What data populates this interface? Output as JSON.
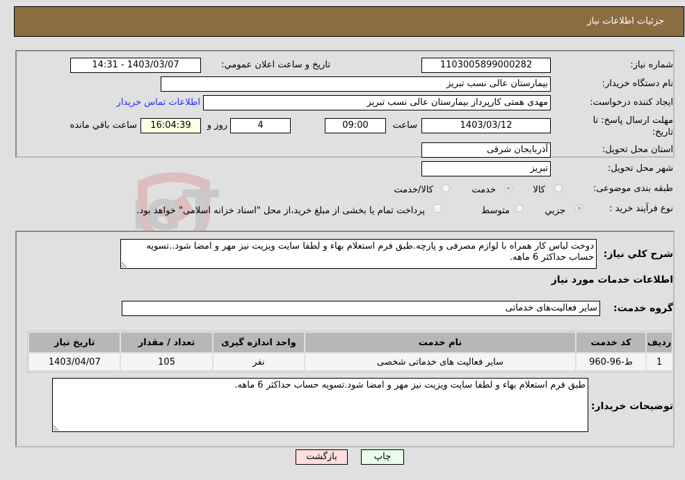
{
  "header": {
    "title": "جزئیات اطلاعات نیاز"
  },
  "form": {
    "need_number": {
      "label": "شماره نیاز:",
      "value": "1103005899000282"
    },
    "announce_datetime": {
      "label": "تاریخ و ساعت اعلان عمومي:",
      "value": "1403/03/07 - 14:31"
    },
    "buyer_org": {
      "label": "نام دستگاه خریدار:",
      "value": "بیمارستان عالی نسب تبریز"
    },
    "requester": {
      "label": "ایجاد کننده درخواست:",
      "value": "مهدی همتی کارپرداز بیمارستان عالی نسب تبریز",
      "contact_link": "اطلاعات تماس خریدار"
    },
    "deadline": {
      "label": "مهلت ارسال پاسخ: تا تاریخ:",
      "date": "1403/03/12",
      "time_label": "ساعت",
      "time": "09:00",
      "days": "4",
      "days_label": "روز و",
      "remaining": "16:04:39",
      "remaining_label": "ساعت باقي مانده"
    },
    "province": {
      "label": "استان محل تحویل:",
      "value": "آذربایجان شرقی"
    },
    "city": {
      "label": "شهر محل تحویل:",
      "value": "تبریز"
    },
    "category": {
      "label": "طبقه بندی موضوعی:",
      "options": [
        {
          "label": "کالا",
          "checked": false
        },
        {
          "label": "خدمت",
          "checked": true
        },
        {
          "label": "کالا/خدمت",
          "checked": false
        }
      ]
    },
    "purchase_type": {
      "label": "نوع فرآیند خرید :",
      "options": [
        {
          "label": "جزيي",
          "checked": true
        },
        {
          "label": "متوسط",
          "checked": false
        }
      ],
      "treasury_note": "پرداخت تمام یا بخشی از مبلغ خرید،از محل \"اسناد خزانه اسلامی\" خواهد بود."
    }
  },
  "description": {
    "label": "شرح کلي نیاز:",
    "value": "دوخت لباس کار همراه با لوازم مصرفی و پارچه.طبق فرم استعلام بهاء و لطفا سایت ویزیت نیز مهر و امضا شود..تسویه حساب حداکثر 6 ماهه."
  },
  "services": {
    "section_title": "اطلاعات خدمات مورد نیاز",
    "group_label": "گروه خدمت:",
    "group_value": "سایر فعالیت‌های خدماتی",
    "table": {
      "headers": [
        "ردیف",
        "کد خدمت",
        "نام خدمت",
        "واحد اندازه گیری",
        "تعداد / مقدار",
        "تاریخ نیاز"
      ],
      "rows": [
        [
          "1",
          "ط-96-960",
          "سایر فعالیت های خدماتی شخصی",
          "نفر",
          "105",
          "1403/04/07"
        ]
      ]
    }
  },
  "buyer_notes": {
    "label": "توضیحات خریدار:",
    "value": "طبق فرم استعلام بهاء و لطفا سایت ویزیت نیز مهر و امضا شود.تسویه حساب حداکثر 6 ماهه."
  },
  "buttons": {
    "print": "چاپ",
    "back": "بازگشت"
  },
  "watermark": {
    "text": "AriaTender.neT"
  },
  "colors": {
    "header_bg": "#8b6d42",
    "link": "#2a2aff",
    "print_bg": "#eaffea",
    "back_bg": "#ffdede",
    "timer_bg": "#ffffe6"
  }
}
